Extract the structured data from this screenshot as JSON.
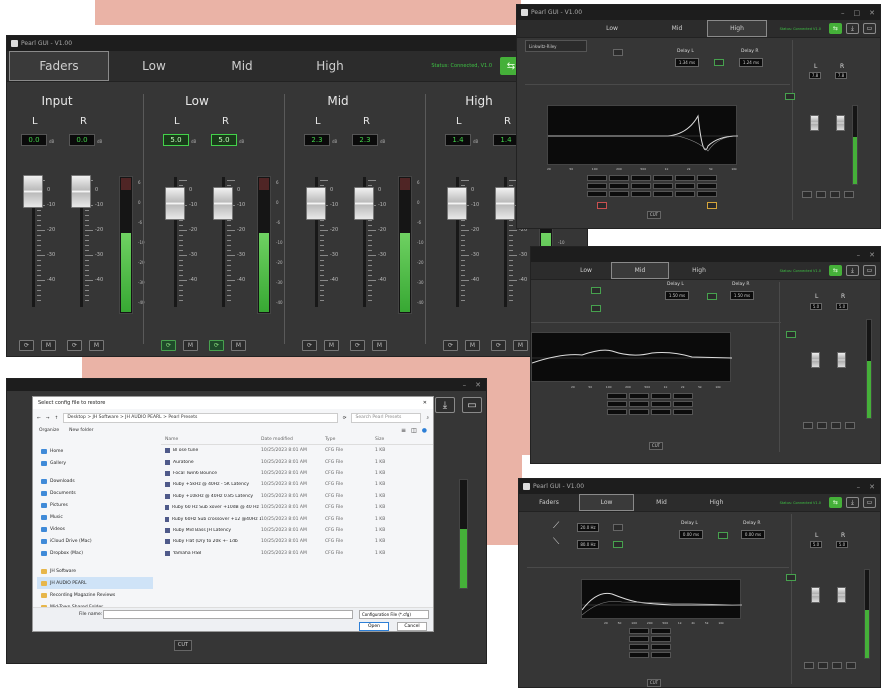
{
  "main_window": {
    "title": "Pearl GUI - V1.00",
    "tabs": [
      "Faders",
      "Low",
      "Mid",
      "High"
    ],
    "active_tab": "Faders",
    "status": "Status: Connected, V1.0",
    "sections": [
      {
        "title": "Input",
        "channels": [
          {
            "label": "L",
            "value": "0.0"
          },
          {
            "label": "R",
            "value": "0.0"
          }
        ]
      },
      {
        "title": "Low",
        "channels": [
          {
            "label": "L",
            "value": "5.0"
          },
          {
            "label": "R",
            "value": "5.0"
          }
        ]
      },
      {
        "title": "Mid",
        "channels": [
          {
            "label": "L",
            "value": "2.3"
          },
          {
            "label": "R",
            "value": "2.3"
          }
        ]
      },
      {
        "title": "High",
        "channels": [
          {
            "label": "L",
            "value": "1.4"
          },
          {
            "label": "R",
            "value": "1.4"
          }
        ]
      }
    ],
    "db_unit": "dB",
    "fader_scale": [
      "0",
      "-10",
      "-20",
      "-30",
      "-40"
    ],
    "meter_scale": [
      "6",
      "0",
      "-6",
      "-10",
      "-20",
      "-30",
      "-40"
    ],
    "mute_label": "M",
    "colors": {
      "accent": "#45b039",
      "bg": "#363636",
      "meter": "#45b039"
    }
  },
  "top_right": {
    "title": "Pearl GUI - V1.00",
    "tabs": [
      "Low",
      "Mid",
      "High"
    ],
    "active_tab": "High",
    "status": "Status: Connected V1.0",
    "delay_l_label": "Delay L",
    "delay_l": "1.34 ms",
    "delay_r_label": "Delay R",
    "delay_r": "1.24 ms",
    "dropdown": "Linkwitz-Riley",
    "chan_labels": [
      "L",
      "R"
    ],
    "chan_values": [
      "7.8",
      "7.8"
    ],
    "eq_x_labels": [
      "20",
      "50",
      "100",
      "200",
      "500",
      "1k",
      "2k",
      "5k",
      "10k"
    ],
    "cut_label": "CUT"
  },
  "mid_right": {
    "tabs": [
      "Low",
      "Mid",
      "High"
    ],
    "active_tab": "Mid",
    "status": "Status: Connected V1.0",
    "delay_l_label": "Delay L",
    "delay_l": "1.50 ms",
    "delay_r_label": "Delay R",
    "delay_r": "1.50 ms",
    "chan_labels": [
      "L",
      "R"
    ],
    "chan_values": [
      "5.0",
      "5.0"
    ],
    "eq_x_labels": [
      "20",
      "50",
      "100",
      "200",
      "500",
      "1k",
      "2k",
      "5k",
      "10k"
    ],
    "cut_label": "CUT"
  },
  "bottom_right": {
    "title": "Pearl GUI - V1.00",
    "tabs": [
      "Faders",
      "Low",
      "Mid",
      "High"
    ],
    "active_tab": "Low",
    "status": "Status: Connected V1.0",
    "hp_value": "20.0 Hz",
    "lp_value": "80.0 Hz",
    "delay_l_label": "Delay L",
    "delay_l": "0.00 ms",
    "delay_r_label": "Delay R",
    "delay_r": "0.00 ms",
    "chan_labels": [
      "L",
      "R"
    ],
    "chan_values": [
      "5.0",
      "5.0"
    ],
    "eq_x_labels": [
      "20",
      "50",
      "100",
      "200",
      "500",
      "1k",
      "2k",
      "5k",
      "10k"
    ],
    "cut_label": "CUT"
  },
  "file_dialog": {
    "title": "Select config file to restore",
    "breadcrumb": "Desktop > JH Software > JH AUDIO PEARL > Pearl Presets",
    "search_placeholder": "Search Pearl Presets",
    "organize": "Organize",
    "new_folder": "New folder",
    "nav_items": [
      "Home",
      "Gallery",
      "Downloads",
      "Documents",
      "Pictures",
      "Music",
      "Videos",
      "iCloud Drive (Mac)",
      "Dropbox (Mac)",
      "JH Software",
      "JH AUDIO PEARL",
      "Recording Magazine Reviews",
      "Mid-Town Shared Folder"
    ],
    "columns": [
      "Name",
      "Date modified",
      "Type",
      "Size"
    ],
    "files": [
      {
        "name": "Bl ose tune",
        "date": "10/25/2023 8:01 AM",
        "type": "CFG File",
        "size": "1 KB"
      },
      {
        "name": "Auratone",
        "date": "10/25/2023 8:01 AM",
        "type": "CFG File",
        "size": "1 KB"
      },
      {
        "name": "Focal Twin6 Bounce",
        "date": "10/25/2023 8:01 AM",
        "type": "CFG File",
        "size": "1 KB"
      },
      {
        "name": "Ruby +5kHz @ 40Hz - 5K Latency",
        "date": "10/25/2023 8:01 AM",
        "type": "CFG File",
        "size": "1 KB"
      },
      {
        "name": "Ruby +10kHz @ 40Hz 0.85 Latency",
        "date": "10/25/2023 8:01 AM",
        "type": "CFG File",
        "size": "1 KB"
      },
      {
        "name": "Ruby 60 Hz Sub xover +10dB @ 40 Hz 1.80 Lat",
        "date": "10/25/2023 8:01 AM",
        "type": "CFG File",
        "size": "1 KB"
      },
      {
        "name": "Ruby 60Hz Sub crossover +12 @40Hz 1.80 Mm...",
        "date": "10/25/2023 8:01 AM",
        "type": "CFG File",
        "size": "1 KB"
      },
      {
        "name": "Ruby Mid Bass JH Latency",
        "date": "10/25/2023 8:01 AM",
        "type": "CFG File",
        "size": "1 KB"
      },
      {
        "name": "Ruby Flat (Dry to 20k +- 1db",
        "date": "10/25/2023 8:01 AM",
        "type": "CFG File",
        "size": "1 KB"
      },
      {
        "name": "Yamaha HS8",
        "date": "10/25/2023 8:01 AM",
        "type": "CFG File",
        "size": "1 KB"
      }
    ],
    "filename_label": "File name:",
    "filetype": "Configuration File (*.cfg)",
    "open": "Open",
    "cancel": "Cancel",
    "cut_label": "CUT"
  }
}
